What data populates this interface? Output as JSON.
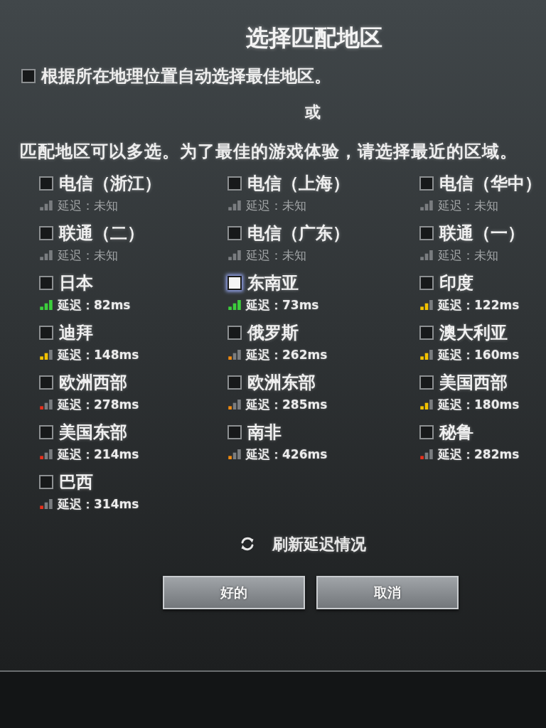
{
  "dialog": {
    "title": "选择匹配地区"
  },
  "auto_select": {
    "label": "根据所在地理位置自动选择最佳地区。",
    "checked": false
  },
  "separator_text": "或",
  "instructions": "匹配地区可以多选。为了最佳的游戏体验，请选择最近的区域。",
  "regions": [
    {
      "name": "电信（浙江）",
      "checked": false,
      "highlighted": false,
      "latency": "延迟：未知",
      "kind": "unknown"
    },
    {
      "name": "电信（上海）",
      "checked": false,
      "highlighted": false,
      "latency": "延迟：未知",
      "kind": "unknown"
    },
    {
      "name": "电信（华中）",
      "checked": false,
      "highlighted": false,
      "latency": "延迟：未知",
      "kind": "unknown"
    },
    {
      "name": "联通（二）",
      "checked": false,
      "highlighted": false,
      "latency": "延迟：未知",
      "kind": "unknown"
    },
    {
      "name": "电信（广东）",
      "checked": false,
      "highlighted": false,
      "latency": "延迟：未知",
      "kind": "unknown"
    },
    {
      "name": "联通（一）",
      "checked": false,
      "highlighted": false,
      "latency": "延迟：未知",
      "kind": "unknown"
    },
    {
      "name": "日本",
      "checked": false,
      "highlighted": false,
      "latency": "延迟：82ms",
      "kind": "strong",
      "color": "#3ccf3c"
    },
    {
      "name": "东南亚",
      "checked": false,
      "highlighted": true,
      "latency": "延迟：73ms",
      "kind": "strong",
      "color": "#3ccf3c"
    },
    {
      "name": "印度",
      "checked": false,
      "highlighted": false,
      "latency": "延迟：122ms",
      "kind": "medium",
      "color": "#f2c200"
    },
    {
      "name": "迪拜",
      "checked": false,
      "highlighted": false,
      "latency": "延迟：148ms",
      "kind": "medium",
      "color": "#f2c200"
    },
    {
      "name": "俄罗斯",
      "checked": false,
      "highlighted": false,
      "latency": "延迟：262ms",
      "kind": "weak",
      "color": "#f08a10"
    },
    {
      "name": "澳大利亚",
      "checked": false,
      "highlighted": false,
      "latency": "延迟：160ms",
      "kind": "medium",
      "color": "#f2c200"
    },
    {
      "name": "欧洲西部",
      "checked": false,
      "highlighted": false,
      "latency": "延迟：278ms",
      "kind": "weak",
      "color": "#e8301c"
    },
    {
      "name": "欧洲东部",
      "checked": false,
      "highlighted": false,
      "latency": "延迟：285ms",
      "kind": "weak",
      "color": "#f08a10"
    },
    {
      "name": "美国西部",
      "checked": false,
      "highlighted": false,
      "latency": "延迟：180ms",
      "kind": "medium",
      "color": "#f2c200"
    },
    {
      "name": "美国东部",
      "checked": false,
      "highlighted": false,
      "latency": "延迟：214ms",
      "kind": "weak",
      "color": "#e8301c"
    },
    {
      "name": "南非",
      "checked": false,
      "highlighted": false,
      "latency": "延迟：426ms",
      "kind": "weak",
      "color": "#f08a10"
    },
    {
      "name": "秘鲁",
      "checked": false,
      "highlighted": false,
      "latency": "延迟：282ms",
      "kind": "weak",
      "color": "#e8301c"
    },
    {
      "name": "巴西",
      "checked": false,
      "highlighted": false,
      "latency": "延迟：314ms",
      "kind": "weak",
      "color": "#e8301c"
    }
  ],
  "refresh": {
    "label": "刷新延迟情况"
  },
  "buttons": [
    "好的",
    "取消"
  ]
}
